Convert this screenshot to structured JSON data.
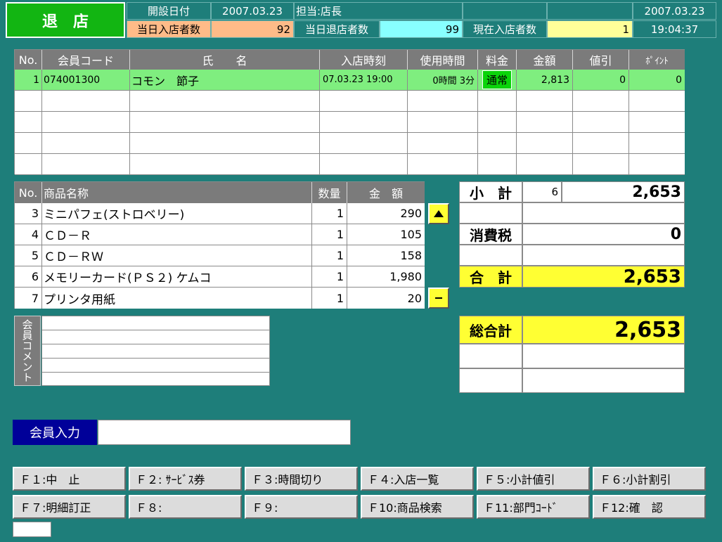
{
  "header": {
    "title": "退　店",
    "open_date_label": "開設日付",
    "open_date_value": "2007.03.23",
    "staff": "担当:店長",
    "date": "2007.03.23",
    "enter_count_label": "当日入店者数",
    "enter_count": "92",
    "exit_count_label": "当日退店者数",
    "exit_count": "99",
    "current_count_label": "現在入店者数",
    "current_count": "1",
    "time": "19:04:37"
  },
  "member_table": {
    "headers": [
      "No.",
      "会員コード",
      "氏　　名",
      "入店時刻",
      "使用時間",
      "料金",
      "金額",
      "値引",
      "ﾎﾟｲﾝﾄ"
    ],
    "rows": [
      {
        "no": "1",
        "code": "074001300",
        "name": "コモン　節子",
        "enter": "07.03.23 19:00",
        "usage": "0時間 3分",
        "rate": "通常",
        "amount": "2,813",
        "discount": "0",
        "point": "0"
      }
    ]
  },
  "item_table": {
    "headers": [
      "No.",
      "商品名称",
      "数量",
      "金　額"
    ],
    "rows": [
      {
        "no": "3",
        "name": "ミニパフェ(ストロベリー)",
        "qty": "1",
        "amount": "290"
      },
      {
        "no": "4",
        "name": "ＣＤ－Ｒ",
        "qty": "1",
        "amount": "105"
      },
      {
        "no": "5",
        "name": "ＣＤ－ＲＷ",
        "qty": "1",
        "amount": "158"
      },
      {
        "no": "6",
        "name": "メモリーカード(ＰＳ２) ケムコ",
        "qty": "1",
        "amount": "1,980"
      },
      {
        "no": "7",
        "name": "プリンタ用紙",
        "qty": "1",
        "amount": "20"
      }
    ],
    "scroll_up_icon": "triangle-up-icon",
    "scroll_down_icon": "dash-icon"
  },
  "comment": {
    "label": "会員コメント"
  },
  "totals": {
    "subtotal_label": "小　計",
    "subtotal_count": "6",
    "subtotal": "2,653",
    "tax_label": "消費税",
    "tax": "0",
    "total_label": "合　計",
    "total": "2,653",
    "grand_label": "総合計",
    "grand": "2,653"
  },
  "member_input": {
    "label": "会員入力",
    "value": ""
  },
  "fkeys": [
    "Ｆ１:中　止",
    "Ｆ２: ｻｰﾋﾞｽ券",
    "Ｆ３:時間切り",
    "Ｆ４:入店一覧",
    "Ｆ５:小計値引",
    "Ｆ６:小計割引",
    "Ｆ７:明細訂正",
    "Ｆ８:",
    "Ｆ９:",
    "Ｆ10:商品検索",
    "Ｆ11:部門ｺｰﾄﾞ",
    "Ｆ12:確　認"
  ],
  "colors": {
    "background": "#1e7e7a",
    "title_green": "#12b512",
    "highlight_row": "#7fee7f",
    "yellow": "#ffff33",
    "orange": "#ffbb88",
    "cyan": "#88ffff",
    "input_blue": "#000099"
  }
}
